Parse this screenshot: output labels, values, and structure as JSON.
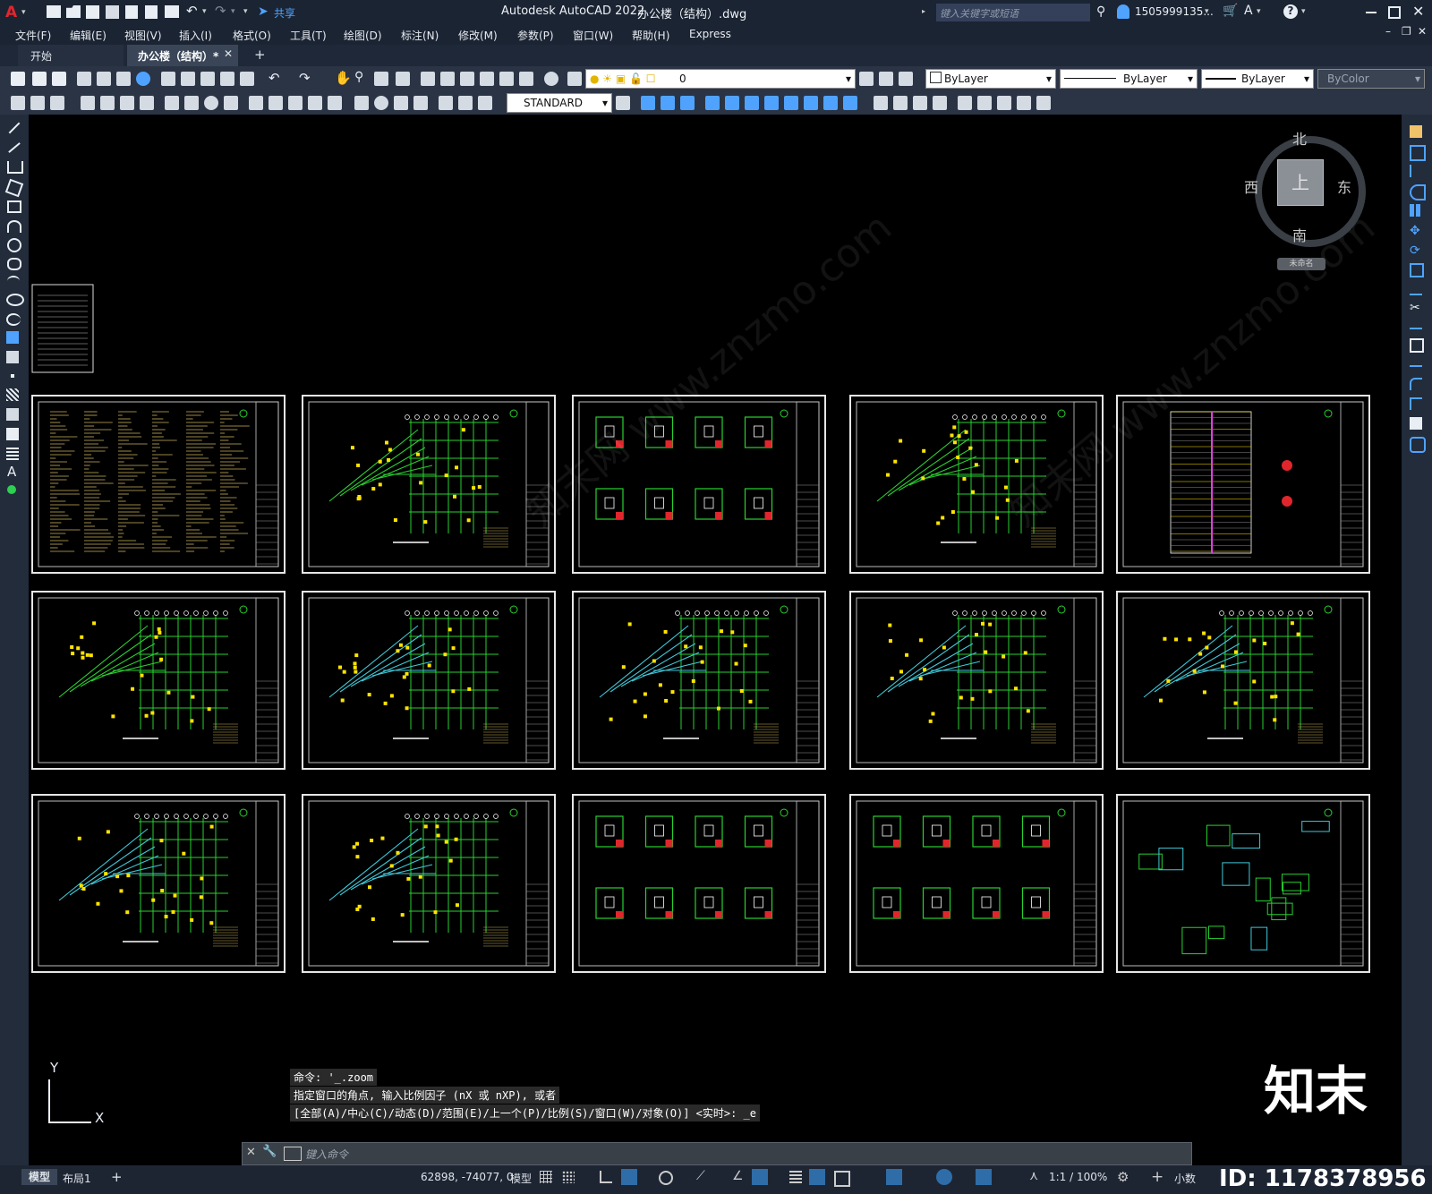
{
  "app": {
    "title": "Autodesk AutoCAD 2022",
    "filename": "办公楼（结构）.dwg",
    "share_label": "共享",
    "search_placeholder": "键入关键字或短语",
    "user": "1505999135...",
    "logo": "A"
  },
  "menu": [
    "文件(F)",
    "编辑(E)",
    "视图(V)",
    "插入(I)",
    "格式(O)",
    "工具(T)",
    "绘图(D)",
    "标注(N)",
    "修改(M)",
    "参数(P)",
    "窗口(W)",
    "帮助(H)",
    "Express"
  ],
  "tabs": {
    "start": "开始",
    "active": "办公楼（结构）*",
    "close": "✕",
    "add": "+"
  },
  "toolbar": {
    "layer_value": "0",
    "linetype1": "ByLayer",
    "linetype2": "ByLayer",
    "lineweight": "ByLayer",
    "color": "ByColor",
    "style": "STANDARD"
  },
  "viewcube": {
    "north": "北",
    "south": "南",
    "east": "东",
    "west": "西",
    "top": "上",
    "wcs": "未命名"
  },
  "ucs": {
    "y": "Y",
    "x": "X"
  },
  "command": {
    "history": [
      "命令: '_.zoom",
      "指定窗口的角点, 输入比例因子 (nX 或 nXP), 或者",
      "[全部(A)/中心(C)/动态(D)/范围(E)/上一个(P)/比例(S)/窗口(W)/对象(O)] <实时>: _e"
    ],
    "placeholder": "键入命令"
  },
  "layout_tabs": [
    "模型",
    "布局1",
    "+"
  ],
  "status": {
    "coords": "62898, -74077, 0",
    "mode": "模型",
    "scale": "1:1 / 100%",
    "units": "小数"
  },
  "watermark": {
    "brand": "知末",
    "id": "ID: 1178378956"
  }
}
